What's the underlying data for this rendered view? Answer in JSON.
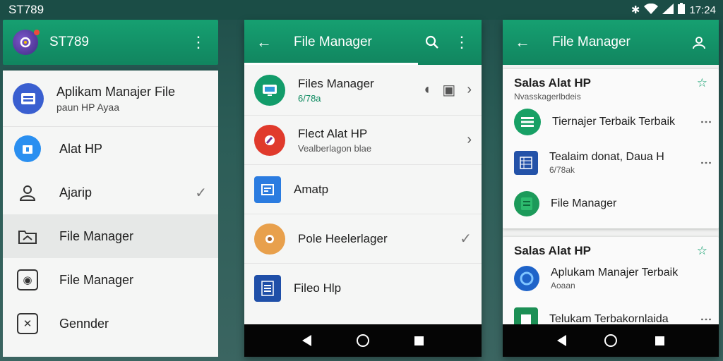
{
  "statusbar": {
    "title": "ST789",
    "time": "17:24"
  },
  "panel1": {
    "app_title": "ST789",
    "header": {
      "title": "Aplikam Manajer File",
      "subtitle": "paun HP Ayaa"
    },
    "items": [
      {
        "label": "Alat HP",
        "icon": "toolbox-icon"
      },
      {
        "label": "Ajarip",
        "icon": "profile-icon",
        "checked": true
      },
      {
        "label": "File Manager",
        "icon": "folder-icon",
        "active": true
      },
      {
        "label": "File Manager",
        "icon": "eye-icon"
      },
      {
        "label": "Gennder",
        "icon": "image-icon"
      }
    ]
  },
  "panel2": {
    "title": "File Manager",
    "rows": [
      {
        "main": "Files Manager",
        "sub": "6/78a"
      },
      {
        "main": "Flect Alat HP",
        "sub": "Vealberlagon blae"
      },
      {
        "main": "Amatp"
      },
      {
        "main": "Pole Heelerlager"
      },
      {
        "main": "Fileo Hlp"
      }
    ]
  },
  "panel3": {
    "title": "File Manager",
    "card1": {
      "title": "Salas Alat HP",
      "subtitle": "Nvasskagerlbdeis",
      "rows": [
        {
          "main": "Tiernajer Terbaik Terbaik",
          "sub": ""
        },
        {
          "main": "Tealaim donat, Daua H",
          "sub": "6/78ak"
        },
        {
          "main": "File Manager",
          "sub": ""
        }
      ]
    },
    "card2": {
      "title": "Salas Alat HP",
      "rows": [
        {
          "main": "Aplukam Manajer Terbaik",
          "sub": "Aoaan"
        },
        {
          "main": "Telukam Terbakornlaida",
          "sub": ""
        }
      ]
    }
  },
  "colors": {
    "primary": "#14956a",
    "statusbar": "#1b4d46"
  }
}
